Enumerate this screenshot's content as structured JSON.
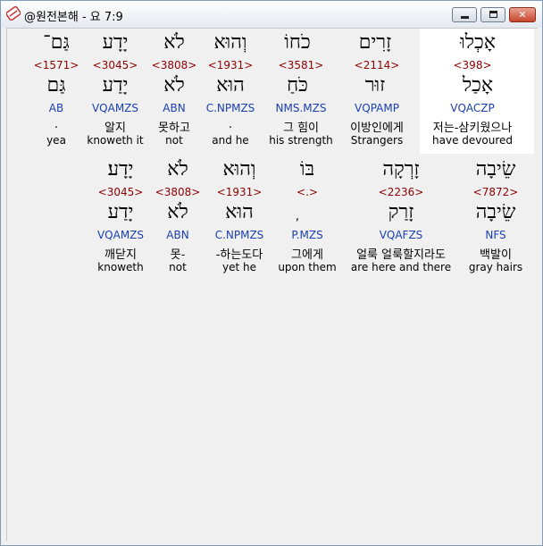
{
  "window": {
    "title": "@원전본해 - 요 7:9",
    "min_icon": "minimize-icon",
    "max_icon": "maximize-icon",
    "close_icon": "close-icon"
  },
  "rows": [
    {
      "words": [
        {
          "hebrew": "אָכְלוּ",
          "strong": "<398>",
          "lemma": "אָכַל",
          "morph": "VQACZP",
          "korean": "저는-삼키웠으나",
          "english": "have devoured",
          "selected": true
        },
        {
          "hebrew": "זָרִים",
          "strong": "<2114>",
          "lemma": "זוּר",
          "morph": "VQPAMP",
          "korean": "이방인에게",
          "english": "Strangers"
        },
        {
          "hebrew": "כֹחוֹ",
          "strong": "<3581>",
          "lemma": "כֹּחַ",
          "morph": "NMS.MZS",
          "korean": "그 힘이",
          "english": "his strength"
        },
        {
          "hebrew": "וְהוּא",
          "strong": "<1931>",
          "lemma": "הוּא",
          "morph": "C.NPMZS",
          "korean": ".",
          "english": "and he"
        },
        {
          "hebrew": "לֹא",
          "strong": "<3808>",
          "lemma": "לֹא",
          "morph": "ABN",
          "korean": "못하고",
          "english": "not"
        },
        {
          "hebrew": "יָדָע",
          "strong": "<3045>",
          "lemma": "יָדַע",
          "morph": "VQAMZS",
          "korean": "알지",
          "english": "knoweth it"
        },
        {
          "hebrew": "גַּם־",
          "strong": "<1571>",
          "lemma": "גַּם",
          "morph": "AB",
          "korean": ".",
          "english": "yea"
        }
      ]
    },
    {
      "words": [
        {
          "hebrew": "שֵׂיבָה",
          "strong": "<7872>",
          "lemma": "שֵׂיבָה",
          "morph": "NFS",
          "korean": "백발이",
          "english": "gray hairs"
        },
        {
          "hebrew": "זָרְקָה",
          "strong": "<2236>",
          "lemma": "זָרַק",
          "morph": "VQAFZS",
          "korean": "얼룩 얼룩할지라도",
          "english": "are here and there"
        },
        {
          "hebrew": "בּוֹ",
          "strong": "<.>",
          "lemma": ",",
          "morph": "P.MZS",
          "korean": "그에게",
          "english": "upon them"
        },
        {
          "hebrew": "וְהוּא",
          "strong": "<1931>",
          "lemma": "הוּא",
          "morph": "C.NPMZS",
          "korean": "-하는도다",
          "english": "yet he"
        },
        {
          "hebrew": "לֹא",
          "strong": "<3808>",
          "lemma": "לֹא",
          "morph": "ABN",
          "korean": "못-",
          "english": "not"
        },
        {
          "hebrew": "יָדָע׃",
          "strong": "<3045>",
          "lemma": "יָדַע",
          "morph": "VQAMZS",
          "korean": "깨닫지",
          "english": "knoweth"
        }
      ]
    }
  ]
}
